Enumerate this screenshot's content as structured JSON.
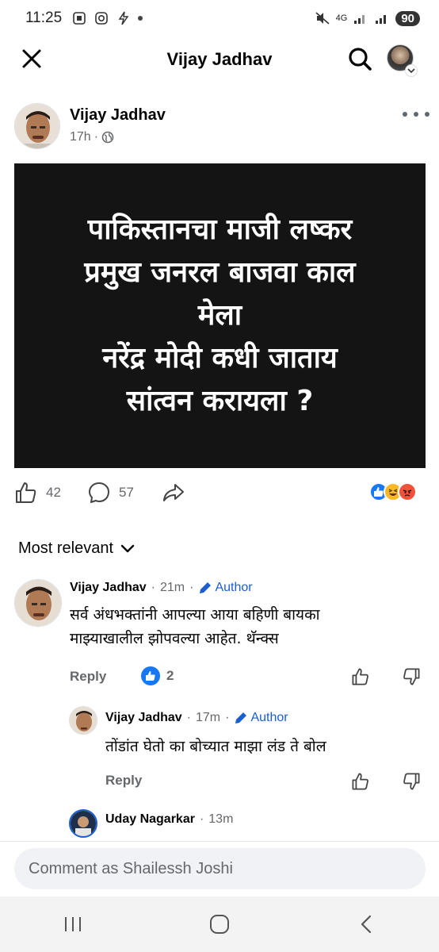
{
  "status_bar": {
    "time": "11:25",
    "network": "4G",
    "battery": "90"
  },
  "header": {
    "title": "Vijay Jadhav"
  },
  "post": {
    "author": "Vijay Jadhav",
    "time": "17h",
    "image_text": "पाकिस्तानचा माजी लष्कर\nप्रमुख जनरल बाजवा  काल\nमेला\nनरेंद्र मोदी कधी जाताय\nसांत्वन करायला ?",
    "likes": "42",
    "comments": "57",
    "reactions": [
      "like",
      "haha",
      "angry"
    ]
  },
  "comments_section": {
    "sort_label": "Most relevant",
    "comments": [
      {
        "name": "Vijay Jadhav",
        "time": "21m",
        "badge": "Author",
        "text": "सर्व अंधभक्तांनी आपल्या आया बहिणी बायका\nमाझ्याखालील  झोपवल्या आहेत. थॅन्क्स",
        "reply_label": "Reply",
        "reaction_count": "2"
      },
      {
        "name": "Vijay Jadhav",
        "time": "17m",
        "badge": "Author",
        "text": "तोंडांत घेतो का बोच्यात माझा लंड ते बोल",
        "reply_label": "Reply"
      },
      {
        "name": "Uday Nagarkar",
        "time": "13m"
      }
    ]
  },
  "comment_input": {
    "placeholder": "Comment as Shailessh Joshi"
  },
  "colors": {
    "link_blue": "#1b5ecf",
    "fb_blue": "#1877f2",
    "muted": "#65676b"
  }
}
